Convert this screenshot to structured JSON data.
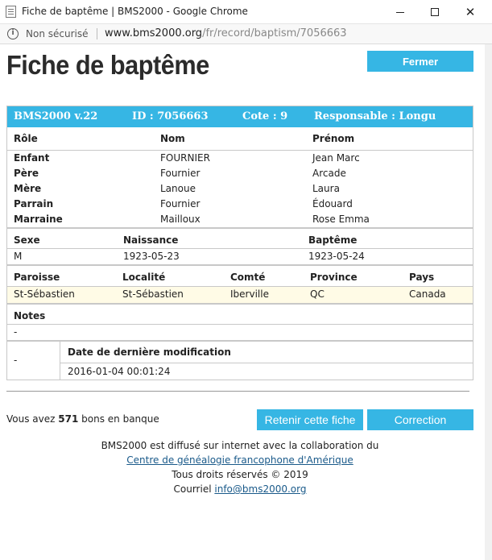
{
  "window": {
    "title": "Fiche de baptême | BMS2000 - Google Chrome",
    "minimize_symbol": "",
    "close_symbol": "✕"
  },
  "address": {
    "security_text": "Non sécurisé",
    "url_host": "www.bms2000.org",
    "url_path": "/fr/record/baptism/7056663"
  },
  "page": {
    "title": "Fiche de baptême",
    "close_button": "Fermer"
  },
  "record": {
    "header": {
      "version": "BMS2000 v.22",
      "id": "ID : 7056663",
      "cote": "Cote : 9",
      "responsable": "Responsable : Longu"
    },
    "people_headers": [
      "Rôle",
      "Nom",
      "Prénom"
    ],
    "people": [
      {
        "role": "Enfant",
        "nom": "FOURNIER",
        "prenom": "Jean Marc"
      },
      {
        "role": "Père",
        "nom": "Fournier",
        "prenom": "Arcade"
      },
      {
        "role": "Mère",
        "nom": "Lanoue",
        "prenom": "Laura"
      },
      {
        "role": "Parrain",
        "nom": "Fournier",
        "prenom": "Édouard"
      },
      {
        "role": "Marraine",
        "nom": "Mailloux",
        "prenom": "Rose Emma"
      }
    ],
    "dates_headers": [
      "Sexe",
      "Naissance",
      "Baptême"
    ],
    "dates": {
      "sexe": "M",
      "naissance": "1923-05-23",
      "bapteme": "1923-05-24"
    },
    "place_headers": [
      "Paroisse",
      "Localité",
      "Comté",
      "Province",
      "Pays"
    ],
    "place": {
      "paroisse": "St-Sébastien",
      "localite": "St-Sébastien",
      "comte": "Iberville",
      "province": "QC",
      "pays": "Canada"
    },
    "notes_header": "Notes",
    "notes_value": "-",
    "bottom_left": "-",
    "modified_header": "Date de dernière modification",
    "modified_value": "2016-01-04 00:01:24"
  },
  "bank": {
    "prefix": "Vous avez",
    "count": "571",
    "suffix": "bons en banque"
  },
  "actions": {
    "retain": "Retenir cette fiche",
    "correction": "Correction"
  },
  "footer": {
    "line1": "BMS2000 est diffusé sur internet avec la collaboration du",
    "link1": "Centre de généalogie francophone d'Amérique",
    "line3": "Tous droits réservés © 2019",
    "email_prefix": "Courriel",
    "email": "info@bms2000.org"
  },
  "colors": {
    "accent": "#36b6e4",
    "row_highlight": "#fffbe6",
    "border": "#c8c8c8"
  }
}
